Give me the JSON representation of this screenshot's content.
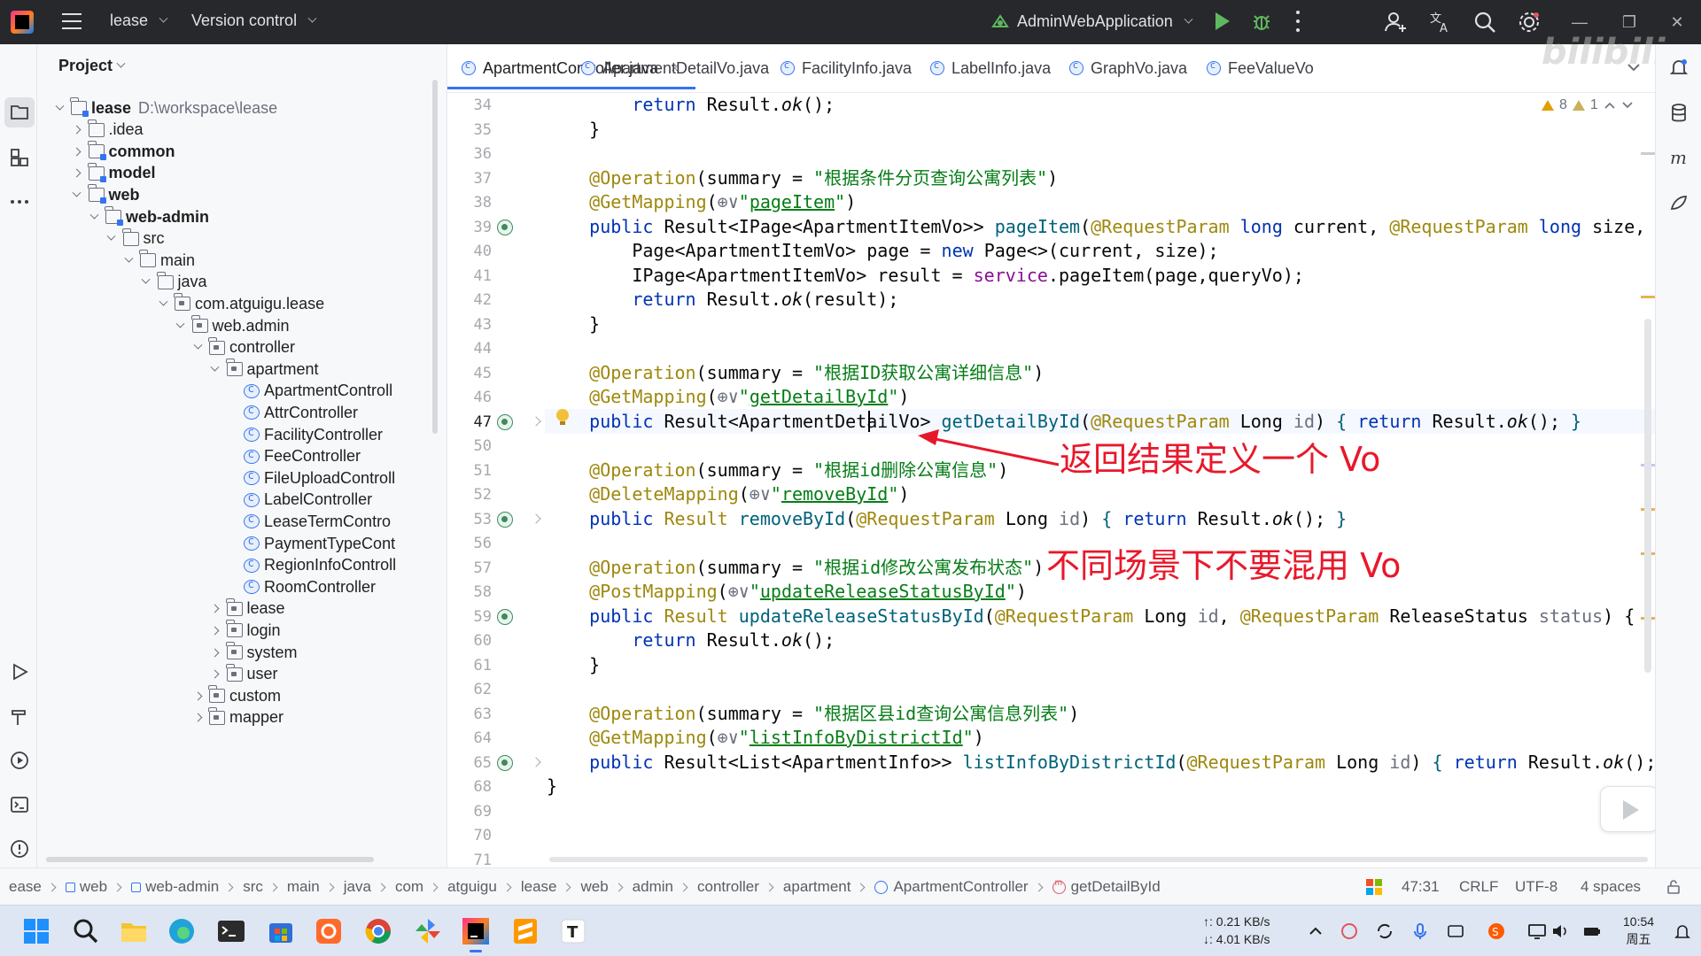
{
  "titlebar": {
    "project": "lease",
    "vcs": "Version control",
    "run_config": "AdminWebApplication"
  },
  "project_panel": {
    "title": "Project",
    "tree": [
      {
        "label": "lease",
        "path": "D:\\workspace\\lease",
        "icon": "module-folder-icon",
        "depth": 0,
        "state": "open",
        "bold": true
      },
      {
        "label": ".idea",
        "icon": "folder-icon",
        "depth": 1,
        "state": "closed"
      },
      {
        "label": "common",
        "icon": "module-folder-icon",
        "depth": 1,
        "state": "closed",
        "bold": true
      },
      {
        "label": "model",
        "icon": "module-folder-icon",
        "depth": 1,
        "state": "closed",
        "bold": true
      },
      {
        "label": "web",
        "icon": "module-folder-icon",
        "depth": 1,
        "state": "open",
        "bold": true
      },
      {
        "label": "web-admin",
        "icon": "module-folder-icon",
        "depth": 2,
        "state": "open",
        "bold": true
      },
      {
        "label": "src",
        "icon": "folder-icon",
        "depth": 3,
        "state": "open"
      },
      {
        "label": "main",
        "icon": "folder-icon",
        "depth": 4,
        "state": "open"
      },
      {
        "label": "java",
        "icon": "source-folder-icon",
        "depth": 5,
        "state": "open"
      },
      {
        "label": "com.atguigu.lease",
        "icon": "package-icon",
        "depth": 6,
        "state": "open"
      },
      {
        "label": "web.admin",
        "icon": "package-icon",
        "depth": 7,
        "state": "open"
      },
      {
        "label": "controller",
        "icon": "package-icon",
        "depth": 8,
        "state": "open"
      },
      {
        "label": "apartment",
        "icon": "package-icon",
        "depth": 9,
        "state": "open"
      },
      {
        "label": "ApartmentControll",
        "icon": "class-icon",
        "depth": 10,
        "state": "leaf"
      },
      {
        "label": "AttrController",
        "icon": "class-icon",
        "depth": 10,
        "state": "leaf"
      },
      {
        "label": "FacilityController",
        "icon": "class-icon",
        "depth": 10,
        "state": "leaf"
      },
      {
        "label": "FeeController",
        "icon": "class-icon",
        "depth": 10,
        "state": "leaf"
      },
      {
        "label": "FileUploadControll",
        "icon": "class-icon",
        "depth": 10,
        "state": "leaf"
      },
      {
        "label": "LabelController",
        "icon": "class-icon",
        "depth": 10,
        "state": "leaf"
      },
      {
        "label": "LeaseTermContro",
        "icon": "class-icon",
        "depth": 10,
        "state": "leaf"
      },
      {
        "label": "PaymentTypeCont",
        "icon": "class-icon",
        "depth": 10,
        "state": "leaf"
      },
      {
        "label": "RegionInfoControll",
        "icon": "class-icon",
        "depth": 10,
        "state": "leaf"
      },
      {
        "label": "RoomController",
        "icon": "class-icon",
        "depth": 10,
        "state": "leaf"
      },
      {
        "label": "lease",
        "icon": "package-icon",
        "depth": 9,
        "state": "closed"
      },
      {
        "label": "login",
        "icon": "package-icon",
        "depth": 9,
        "state": "closed"
      },
      {
        "label": "system",
        "icon": "package-icon",
        "depth": 9,
        "state": "closed"
      },
      {
        "label": "user",
        "icon": "package-icon",
        "depth": 9,
        "state": "closed"
      },
      {
        "label": "custom",
        "icon": "package-icon",
        "depth": 8,
        "state": "closed"
      },
      {
        "label": "mapper",
        "icon": "package-icon",
        "depth": 8,
        "state": "closed"
      }
    ]
  },
  "editor": {
    "tabs": [
      {
        "label": "ApartmentController.java",
        "active": true
      },
      {
        "label": "ApartmentDetailVo.java"
      },
      {
        "label": "FacilityInfo.java"
      },
      {
        "label": "LabelInfo.java"
      },
      {
        "label": "GraphVo.java"
      },
      {
        "label": "FeeValueVo"
      }
    ],
    "inspections": {
      "warnings": "8",
      "weak_warnings": "1"
    },
    "gutter": [
      {
        "n": "34"
      },
      {
        "n": "35"
      },
      {
        "n": "36"
      },
      {
        "n": "37"
      },
      {
        "n": "38"
      },
      {
        "n": "39",
        "mark": true
      },
      {
        "n": "40"
      },
      {
        "n": "41"
      },
      {
        "n": "42"
      },
      {
        "n": "43"
      },
      {
        "n": "44"
      },
      {
        "n": "45"
      },
      {
        "n": "46"
      },
      {
        "n": "47",
        "mark": true,
        "fold": true,
        "current": true
      },
      {
        "n": "50"
      },
      {
        "n": "51"
      },
      {
        "n": "52"
      },
      {
        "n": "53",
        "mark": true,
        "fold": true
      },
      {
        "n": "56"
      },
      {
        "n": "57"
      },
      {
        "n": "58"
      },
      {
        "n": "59",
        "mark": true
      },
      {
        "n": "60"
      },
      {
        "n": "61"
      },
      {
        "n": "62"
      },
      {
        "n": "63"
      },
      {
        "n": "64"
      },
      {
        "n": "65",
        "mark": true,
        "fold": true
      },
      {
        "n": "68"
      },
      {
        "n": "69"
      },
      {
        "n": "70"
      },
      {
        "n": "71"
      }
    ],
    "lines": [
      {
        "t": [
          [
            "        ",
            ""
          ],
          [
            "return",
            "kw"
          ],
          [
            " Result.",
            ""
          ],
          [
            "ok",
            "it"
          ],
          [
            "();",
            ""
          ]
        ]
      },
      {
        "t": [
          [
            "    }",
            ""
          ]
        ]
      },
      {
        "t": [
          [
            "",
            ""
          ]
        ]
      },
      {
        "t": [
          [
            "    ",
            ""
          ],
          [
            "@Operation",
            "an"
          ],
          [
            "(summary = ",
            ""
          ],
          [
            "\"根据条件分页查询公寓列表\"",
            "st"
          ],
          [
            ")",
            ""
          ]
        ]
      },
      {
        "t": [
          [
            "    ",
            ""
          ],
          [
            "@GetMapping",
            "an"
          ],
          [
            "(",
            ""
          ],
          [
            "⊕∨",
            "pm"
          ],
          [
            "\"",
            "st"
          ],
          [
            "pageItem",
            "st ul"
          ],
          [
            "\"",
            "st"
          ],
          [
            ")",
            ""
          ]
        ]
      },
      {
        "t": [
          [
            "    ",
            ""
          ],
          [
            "public",
            "kw"
          ],
          [
            " Result<IPage<ApartmentItemVo>> ",
            ""
          ],
          [
            "pageItem",
            "fn"
          ],
          [
            "(",
            ""
          ],
          [
            "@RequestParam",
            "an"
          ],
          [
            " ",
            ""
          ],
          [
            "long",
            "kw"
          ],
          [
            " current, ",
            ""
          ],
          [
            "@RequestParam",
            "an"
          ],
          [
            " ",
            ""
          ],
          [
            "long",
            "kw"
          ],
          [
            " size, ",
            ""
          ]
        ]
      },
      {
        "t": [
          [
            "        Page<ApartmentItemVo> page = ",
            ""
          ],
          [
            "new",
            "kw"
          ],
          [
            " Page<>(current, size);",
            ""
          ]
        ]
      },
      {
        "t": [
          [
            "        IPage<ApartmentItemVo> result = ",
            ""
          ],
          [
            "service",
            "fd"
          ],
          [
            ".pageItem(page,queryVo);",
            ""
          ]
        ]
      },
      {
        "t": [
          [
            "        ",
            ""
          ],
          [
            "return",
            "kw"
          ],
          [
            " Result.",
            ""
          ],
          [
            "ok",
            "it"
          ],
          [
            "(result);",
            ""
          ]
        ]
      },
      {
        "t": [
          [
            "    }",
            ""
          ]
        ]
      },
      {
        "t": [
          [
            "",
            ""
          ]
        ]
      },
      {
        "t": [
          [
            "    ",
            ""
          ],
          [
            "@Operation",
            "an"
          ],
          [
            "(summary = ",
            ""
          ],
          [
            "\"根据ID获取公寓详细信息\"",
            "st"
          ],
          [
            ")",
            ""
          ]
        ]
      },
      {
        "t": [
          [
            "    ",
            ""
          ],
          [
            "@GetMapping",
            "an"
          ],
          [
            "(",
            ""
          ],
          [
            "⊕∨",
            "pm"
          ],
          [
            "\"",
            "st"
          ],
          [
            "getDetailById",
            "st ul"
          ],
          [
            "\"",
            "st"
          ],
          [
            ")",
            ""
          ]
        ]
      },
      {
        "t": [
          [
            "    ",
            ""
          ],
          [
            "public",
            "kw"
          ],
          [
            " Result<ApartmentDetailVo> ",
            ""
          ],
          [
            "getDetailById",
            "fn"
          ],
          [
            "(",
            ""
          ],
          [
            "@RequestParam",
            "an"
          ],
          [
            " Long ",
            ""
          ],
          [
            "id",
            "pm"
          ],
          [
            ") ",
            ""
          ],
          [
            "{",
            "fn"
          ],
          [
            " ",
            ""
          ],
          [
            "return",
            "kw"
          ],
          [
            " Result.",
            ""
          ],
          [
            "ok",
            "it"
          ],
          [
            "(); ",
            ""
          ],
          [
            "}",
            "fn"
          ]
        ]
      },
      {
        "t": [
          [
            "",
            ""
          ]
        ]
      },
      {
        "t": [
          [
            "    ",
            ""
          ],
          [
            "@Operation",
            "an"
          ],
          [
            "(summary = ",
            ""
          ],
          [
            "\"根据id删除公寓信息\"",
            "st"
          ],
          [
            ")",
            ""
          ]
        ]
      },
      {
        "t": [
          [
            "    ",
            ""
          ],
          [
            "@DeleteMapping",
            "an"
          ],
          [
            "(",
            ""
          ],
          [
            "⊕∨",
            "pm"
          ],
          [
            "\"",
            "st"
          ],
          [
            "removeById",
            "st ul"
          ],
          [
            "\"",
            "st"
          ],
          [
            ")",
            ""
          ]
        ]
      },
      {
        "t": [
          [
            "    ",
            ""
          ],
          [
            "public",
            "kw"
          ],
          [
            " ",
            ""
          ],
          [
            "Result",
            "an"
          ],
          [
            " ",
            ""
          ],
          [
            "removeById",
            "fn"
          ],
          [
            "(",
            ""
          ],
          [
            "@RequestParam",
            "an"
          ],
          [
            " Long ",
            ""
          ],
          [
            "id",
            "pm"
          ],
          [
            ") ",
            ""
          ],
          [
            "{",
            "fn"
          ],
          [
            " ",
            ""
          ],
          [
            "return",
            "kw"
          ],
          [
            " Result.",
            ""
          ],
          [
            "ok",
            "it"
          ],
          [
            "(); ",
            ""
          ],
          [
            "}",
            "fn"
          ]
        ]
      },
      {
        "t": [
          [
            "",
            ""
          ]
        ]
      },
      {
        "t": [
          [
            "    ",
            ""
          ],
          [
            "@Operation",
            "an"
          ],
          [
            "(summary = ",
            ""
          ],
          [
            "\"根据id修改公寓发布状态\"",
            "st"
          ],
          [
            ")",
            ""
          ]
        ]
      },
      {
        "t": [
          [
            "    ",
            ""
          ],
          [
            "@PostMapping",
            "an"
          ],
          [
            "(",
            ""
          ],
          [
            "⊕∨",
            "pm"
          ],
          [
            "\"",
            "st"
          ],
          [
            "updateReleaseStatusById",
            "st ul"
          ],
          [
            "\"",
            "st"
          ],
          [
            ")",
            ""
          ]
        ]
      },
      {
        "t": [
          [
            "    ",
            ""
          ],
          [
            "public",
            "kw"
          ],
          [
            " ",
            ""
          ],
          [
            "Result",
            "an"
          ],
          [
            " ",
            ""
          ],
          [
            "updateReleaseStatusById",
            "fn"
          ],
          [
            "(",
            ""
          ],
          [
            "@RequestParam",
            "an"
          ],
          [
            " Long ",
            ""
          ],
          [
            "id",
            "pm"
          ],
          [
            ", ",
            ""
          ],
          [
            "@RequestParam",
            "an"
          ],
          [
            " ReleaseStatus ",
            ""
          ],
          [
            "status",
            "pm"
          ],
          [
            ") {",
            ""
          ]
        ]
      },
      {
        "t": [
          [
            "        ",
            ""
          ],
          [
            "return",
            "kw"
          ],
          [
            " Result.",
            ""
          ],
          [
            "ok",
            "it"
          ],
          [
            "();",
            ""
          ]
        ]
      },
      {
        "t": [
          [
            "    }",
            ""
          ]
        ]
      },
      {
        "t": [
          [
            "",
            ""
          ]
        ]
      },
      {
        "t": [
          [
            "    ",
            ""
          ],
          [
            "@Operation",
            "an"
          ],
          [
            "(summary = ",
            ""
          ],
          [
            "\"根据区县id查询公寓信息列表\"",
            "st"
          ],
          [
            ")",
            ""
          ]
        ]
      },
      {
        "t": [
          [
            "    ",
            ""
          ],
          [
            "@GetMapping",
            "an"
          ],
          [
            "(",
            ""
          ],
          [
            "⊕∨",
            "pm"
          ],
          [
            "\"",
            "st"
          ],
          [
            "listInfoByDistrictId",
            "st ul"
          ],
          [
            "\"",
            "st"
          ],
          [
            ")",
            ""
          ]
        ]
      },
      {
        "t": [
          [
            "    ",
            ""
          ],
          [
            "public",
            "kw"
          ],
          [
            " Result<List<ApartmentInfo>> ",
            ""
          ],
          [
            "listInfoByDistrictId",
            "fn"
          ],
          [
            "(",
            ""
          ],
          [
            "@RequestParam",
            "an"
          ],
          [
            " Long ",
            ""
          ],
          [
            "id",
            "pm"
          ],
          [
            ") ",
            ""
          ],
          [
            "{",
            "fn"
          ],
          [
            " ",
            ""
          ],
          [
            "return",
            "kw"
          ],
          [
            " Result.",
            ""
          ],
          [
            "ok",
            "it"
          ],
          [
            "();",
            ""
          ]
        ]
      },
      {
        "t": [
          [
            "}",
            ""
          ]
        ]
      },
      {
        "t": [
          [
            "",
            ""
          ]
        ]
      },
      {
        "t": [
          [
            "",
            ""
          ]
        ]
      },
      {
        "t": [
          [
            "",
            ""
          ]
        ]
      }
    ]
  },
  "annotations": {
    "note1": "返回结果定义一个 Vo",
    "note2": "不同场景下不要混用 Vo",
    "color": "#e8182b"
  },
  "statusbar": {
    "breadcrumbs": [
      "ease",
      "web",
      "web-admin",
      "src",
      "main",
      "java",
      "com",
      "atguigu",
      "lease",
      "web",
      "admin",
      "controller",
      "apartment",
      "ApartmentController",
      "getDetailById"
    ],
    "position": "47:31",
    "line_sep": "CRLF",
    "encoding": "UTF-8",
    "indent": "4 spaces"
  },
  "taskbar": {
    "net_up": "↑: 0.21 KB/s",
    "net_down": "↓: 4.01 KB/s",
    "time": "10:54",
    "day": "周五"
  },
  "colors": {
    "accent": "#3574f0",
    "keyword": "#0033b3",
    "string": "#067d17",
    "annotation": "#9e880d"
  }
}
